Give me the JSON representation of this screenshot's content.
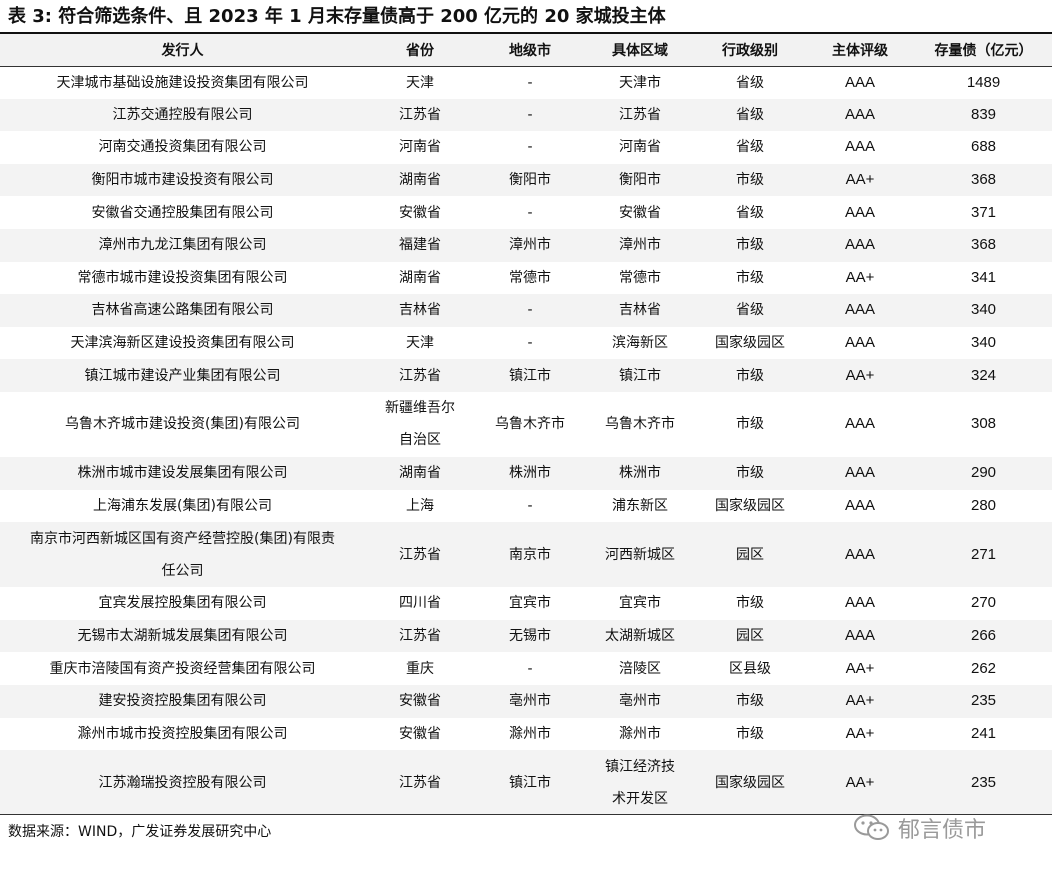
{
  "title": "表 3:  符合筛选条件、且 2023 年 1 月末存量债高于 200 亿元的 20 家城投主体",
  "columns": [
    "发行人",
    "省份",
    "地级市",
    "具体区域",
    "行政级别",
    "主体评级",
    "存量债（亿元）"
  ],
  "rows": [
    [
      "天津城市基础设施建设投资集团有限公司",
      "天津",
      "-",
      "天津市",
      "省级",
      "AAA",
      "1489"
    ],
    [
      "江苏交通控股有限公司",
      "江苏省",
      "-",
      "江苏省",
      "省级",
      "AAA",
      "839"
    ],
    [
      "河南交通投资集团有限公司",
      "河南省",
      "-",
      "河南省",
      "省级",
      "AAA",
      "688"
    ],
    [
      "衡阳市城市建设投资有限公司",
      "湖南省",
      "衡阳市",
      "衡阳市",
      "市级",
      "AA+",
      "368"
    ],
    [
      "安徽省交通控股集团有限公司",
      "安徽省",
      "-",
      "安徽省",
      "省级",
      "AAA",
      "371"
    ],
    [
      "漳州市九龙江集团有限公司",
      "福建省",
      "漳州市",
      "漳州市",
      "市级",
      "AAA",
      "368"
    ],
    [
      "常德市城市建设投资集团有限公司",
      "湖南省",
      "常德市",
      "常德市",
      "市级",
      "AA+",
      "341"
    ],
    [
      "吉林省高速公路集团有限公司",
      "吉林省",
      "-",
      "吉林省",
      "省级",
      "AAA",
      "340"
    ],
    [
      "天津滨海新区建设投资集团有限公司",
      "天津",
      "-",
      "滨海新区",
      "国家级园区",
      "AAA",
      "340"
    ],
    [
      "镇江城市建设产业集团有限公司",
      "江苏省",
      "镇江市",
      "镇江市",
      "市级",
      "AA+",
      "324"
    ],
    [
      "乌鲁木齐城市建设投资(集团)有限公司",
      "新疆维吾尔\n自治区",
      "乌鲁木齐市",
      "乌鲁木齐市",
      "市级",
      "AAA",
      "308"
    ],
    [
      "株洲市城市建设发展集团有限公司",
      "湖南省",
      "株洲市",
      "株洲市",
      "市级",
      "AAA",
      "290"
    ],
    [
      "上海浦东发展(集团)有限公司",
      "上海",
      "-",
      "浦东新区",
      "国家级园区",
      "AAA",
      "280"
    ],
    [
      "南京市河西新城区国有资产经营控股(集团)有限责\n任公司",
      "江苏省",
      "南京市",
      "河西新城区",
      "园区",
      "AAA",
      "271"
    ],
    [
      "宜宾发展控股集团有限公司",
      "四川省",
      "宜宾市",
      "宜宾市",
      "市级",
      "AAA",
      "270"
    ],
    [
      "无锡市太湖新城发展集团有限公司",
      "江苏省",
      "无锡市",
      "太湖新城区",
      "园区",
      "AAA",
      "266"
    ],
    [
      "重庆市涪陵国有资产投资经营集团有限公司",
      "重庆",
      "-",
      "涪陵区",
      "区县级",
      "AA+",
      "262"
    ],
    [
      "建安投资控股集团有限公司",
      "安徽省",
      "亳州市",
      "亳州市",
      "市级",
      "AA+",
      "235"
    ],
    [
      "滁州市城市投资控股集团有限公司",
      "安徽省",
      "滁州市",
      "滁州市",
      "市级",
      "AA+",
      "241"
    ],
    [
      "江苏瀚瑞投资控股有限公司",
      "江苏省",
      "镇江市",
      "镇江经济技\n术开发区",
      "国家级园区",
      "AA+",
      "235"
    ]
  ],
  "source": "数据来源：WIND，广发证券发展研究中心",
  "watermark": {
    "text": "郁言债市",
    "icon": "wechat-icon"
  }
}
